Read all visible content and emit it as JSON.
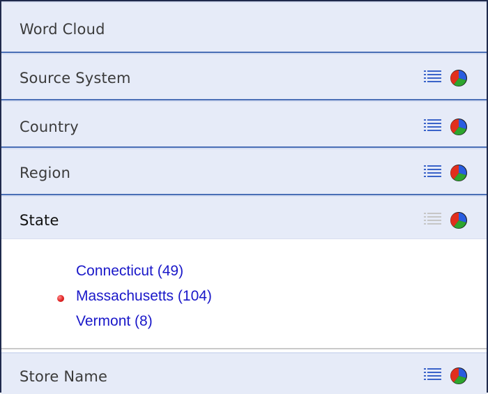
{
  "facets": [
    {
      "id": "word-cloud",
      "label": "Word Cloud",
      "has_icons": false,
      "active": false
    },
    {
      "id": "source-system",
      "label": "Source System",
      "has_icons": true,
      "active": false
    },
    {
      "id": "country",
      "label": "Country",
      "has_icons": true,
      "active": false
    },
    {
      "id": "region",
      "label": "Region",
      "has_icons": true,
      "active": false
    },
    {
      "id": "state",
      "label": "State",
      "has_icons": true,
      "active": true
    },
    {
      "id": "store-name",
      "label": "Store Name",
      "has_icons": true,
      "active": false
    }
  ],
  "state_values": [
    {
      "label": "Connecticut (49)",
      "selected": false
    },
    {
      "label": "Massachusetts (104)",
      "selected": true
    },
    {
      "label": "Vermont (8)",
      "selected": false
    }
  ],
  "colors": {
    "header_bg": "#e6ebf8",
    "header_border": "#4a6fb6",
    "link": "#1a18c9",
    "bullet": "#e02323",
    "panel_border": "#1f2a4d"
  },
  "icons": {
    "list": "list-icon",
    "pie": "pie-chart-icon"
  }
}
